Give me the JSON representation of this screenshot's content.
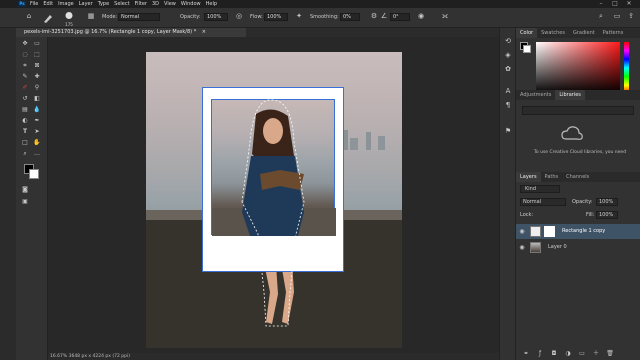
{
  "app": {
    "logo": "Ps"
  },
  "menu": [
    "File",
    "Edit",
    "Image",
    "Layer",
    "Type",
    "Select",
    "Filter",
    "3D",
    "View",
    "Window",
    "Help"
  ],
  "window_controls": [
    "–",
    "□",
    "✕"
  ],
  "options": {
    "brush_size": "175",
    "mode_label": "Mode:",
    "mode_value": "Normal",
    "opacity_label": "Opacity:",
    "opacity_value": "100%",
    "flow_label": "Flow:",
    "flow_value": "100%",
    "smoothing_label": "Smoothing:",
    "smoothing_value": "0%",
    "angle_value": "0°"
  },
  "document_tab": {
    "title": "pexels-imi-3251703.jpg @ 16.7% (Rectangle 1 copy, Layer Mask/8) *",
    "close": "×"
  },
  "status": {
    "text": "16.67%   3648 px x 4224 px (72 ppi)"
  },
  "right_panel": {
    "color_tabs": [
      "Color",
      "Swatches",
      "Gradient",
      "Patterns"
    ],
    "adj_tabs": [
      "Adjustments",
      "Libraries"
    ],
    "library_text": "To use Creative Cloud libraries, you need",
    "layers_tabs": [
      "Layers",
      "Paths",
      "Channels"
    ],
    "kind_label": "Kind",
    "blend_mode": "Normal",
    "opacity_label": "Opacity:",
    "opacity_value": "100%",
    "lock_label": "Lock:",
    "fill_label": "Fill:",
    "fill_value": "100%",
    "layers": [
      {
        "name": "Rectangle 1 copy",
        "selected": true
      },
      {
        "name": "Layer 0",
        "selected": false
      }
    ]
  },
  "colors": {
    "accent": "#31a8ff",
    "selected_layer": "#3f5367",
    "panel": "#323232",
    "workspace": "#282828"
  }
}
